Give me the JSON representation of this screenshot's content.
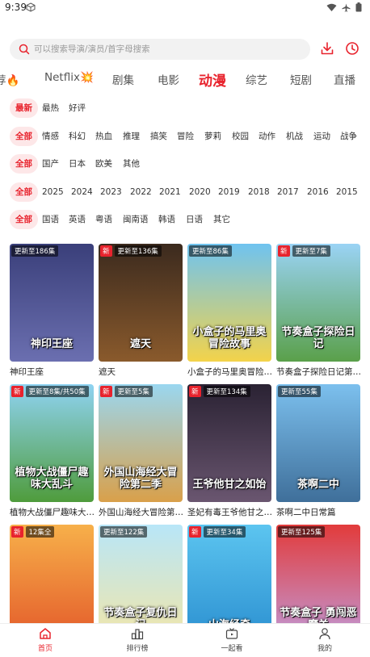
{
  "status_bar": {
    "time": "9:39"
  },
  "search": {
    "placeholder": "可以搜索导演/演员/首字母搜索"
  },
  "categories": [
    {
      "label": "荐🔥"
    },
    {
      "label": "Netflix💥"
    },
    {
      "label": "剧集"
    },
    {
      "label": "电影"
    },
    {
      "label": "动漫",
      "active": true
    },
    {
      "label": "综艺"
    },
    {
      "label": "短剧"
    },
    {
      "label": "直播"
    }
  ],
  "filters": {
    "sort": [
      "最新",
      "最热",
      "好评"
    ],
    "genre": [
      "全部",
      "情感",
      "科幻",
      "热血",
      "推理",
      "搞笑",
      "冒险",
      "萝莉",
      "校园",
      "动作",
      "机战",
      "运动",
      "战争"
    ],
    "region": [
      "全部",
      "国产",
      "日本",
      "欧美",
      "其他"
    ],
    "year": [
      "全部",
      "2025",
      "2024",
      "2023",
      "2022",
      "2021",
      "2020",
      "2019",
      "2018",
      "2017",
      "2016",
      "2015"
    ],
    "language": [
      "全部",
      "国语",
      "英语",
      "粤语",
      "闽南语",
      "韩语",
      "日语",
      "其它"
    ]
  },
  "cards": [
    {
      "title": "神印王座",
      "episodes": "更新至186集",
      "is_new": false,
      "color_top": "#3a3f7a",
      "color_bottom": "#6b6fb0"
    },
    {
      "title": "遮天",
      "episodes": "更新至136集",
      "is_new": true,
      "new_label": "新",
      "color_top": "#3b2a1e",
      "color_bottom": "#8a5a2c"
    },
    {
      "title": "小盒子的马里奥冒险…",
      "episodes": "更新至86集",
      "is_new": false,
      "color_top": "#6fc3f0",
      "color_bottom": "#f3d34a"
    },
    {
      "title": "节奏盒子探险日记第…",
      "episodes": "更新至7集",
      "is_new": true,
      "new_label": "新",
      "color_top": "#9ad3f5",
      "color_bottom": "#5aa04a"
    },
    {
      "title": "植物大战僵尸趣味大…",
      "episodes": "更新至8集/共50集",
      "is_new": true,
      "new_label": "新",
      "color_top": "#8fd3f2",
      "color_bottom": "#4f9c3c"
    },
    {
      "title": "外国山海经大冒险第…",
      "episodes": "更新至5集",
      "is_new": true,
      "new_label": "新",
      "color_top": "#9ad7f0",
      "color_bottom": "#d9a04a"
    },
    {
      "title": "圣妃有毒王爷他甘之…",
      "episodes": "更新至134集",
      "is_new": true,
      "new_label": "新",
      "color_top": "#2a2233",
      "color_bottom": "#6a5670"
    },
    {
      "title": "茶啊二中日常篇",
      "episodes": "更新至55集",
      "is_new": false,
      "color_top": "#7cc0ee",
      "color_bottom": "#3f6f9a"
    },
    {
      "title": "",
      "episodes": "12集全",
      "is_new": true,
      "new_label": "新",
      "color_top": "#f7b04a",
      "color_bottom": "#e35a2a"
    },
    {
      "title": "",
      "episodes": "更新至122集",
      "is_new": false,
      "color_top": "#b8e6f8",
      "color_bottom": "#f2e6a8"
    },
    {
      "title": "",
      "episodes": "更新至34集",
      "is_new": true,
      "new_label": "新",
      "color_top": "#5cc5f0",
      "color_bottom": "#2b8fd0"
    },
    {
      "title": "",
      "episodes": "更新至125集",
      "is_new": false,
      "color_top": "#e23b3b",
      "color_bottom": "#c19ad8"
    }
  ],
  "poster_texts": {
    "c0": "神印王座",
    "c1": "遮天",
    "c2": "小盒子的马里奥冒险故事",
    "c3": "节奏盒子探险日记",
    "c4": "植物大战僵尸趣味大乱斗",
    "c5": "外国山海经大冒险第二季",
    "c6": "王爷他甘之如饴",
    "c7": "茶啊二中",
    "c9": "节奏盒子复仇日记",
    "c10": "山海经奇",
    "c11": "节奏盒子 勇闯恶魔关"
  },
  "bottom_nav": [
    {
      "label": "首页",
      "active": true
    },
    {
      "label": "排行榜"
    },
    {
      "label": "一起看"
    },
    {
      "label": "我的"
    }
  ],
  "colors": {
    "accent": "#e8232d",
    "chip_bg": "#fde7e8"
  }
}
